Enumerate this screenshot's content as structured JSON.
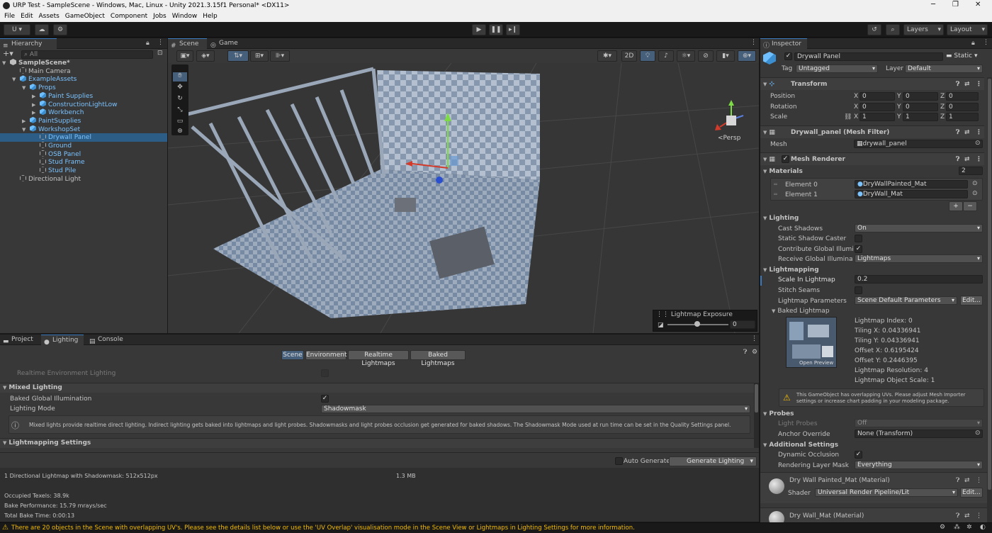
{
  "window": {
    "title": "URP Test - SampleScene - Windows, Mac, Linux - Unity 2021.3.15f1 Personal* <DX11>"
  },
  "menu": [
    "File",
    "Edit",
    "Assets",
    "GameObject",
    "Component",
    "Jobs",
    "Window",
    "Help"
  ],
  "toolbar": {
    "account": "U ▾",
    "layers": "Layers",
    "layout": "Layout"
  },
  "hierarchy": {
    "tab": "Hierarchy",
    "search_placeholder": "All",
    "items": [
      {
        "label": "SampleScene*",
        "depth": 0,
        "icon": "unity-scene-icon",
        "arrow": "▼"
      },
      {
        "label": "Main Camera",
        "depth": 1,
        "icon": "gameobject-icon"
      },
      {
        "label": "ExampleAssets",
        "depth": 1,
        "icon": "prefab-icon",
        "arrow": "▼",
        "blue": true
      },
      {
        "label": "Props",
        "depth": 2,
        "icon": "prefab-icon",
        "arrow": "▼",
        "blue": true
      },
      {
        "label": "Paint Supplies",
        "depth": 3,
        "icon": "prefab-icon",
        "arrow": "▶",
        "blue": true
      },
      {
        "label": "ConstructionLightLow",
        "depth": 3,
        "icon": "prefab-icon",
        "arrow": "▶",
        "blue": true
      },
      {
        "label": "Workbench",
        "depth": 3,
        "icon": "prefab-icon",
        "arrow": "▶",
        "blue": true
      },
      {
        "label": "PaintSupplies",
        "depth": 2,
        "icon": "prefab-icon",
        "arrow": "▶",
        "blue": true
      },
      {
        "label": "WorkshopSet",
        "depth": 2,
        "icon": "prefab-icon",
        "arrow": "▼",
        "blue": true
      },
      {
        "label": "Drywall Panel",
        "depth": 3,
        "icon": "gameobject-icon",
        "blue": true,
        "selected": true
      },
      {
        "label": "Ground",
        "depth": 3,
        "icon": "gameobject-icon",
        "blue": true
      },
      {
        "label": "OSB Panel",
        "depth": 3,
        "icon": "gameobject-icon",
        "blue": true
      },
      {
        "label": "Stud Frame",
        "depth": 3,
        "icon": "gameobject-icon",
        "blue": true
      },
      {
        "label": "Stud Pile",
        "depth": 3,
        "icon": "gameobject-icon",
        "blue": true
      },
      {
        "label": "Directional Light",
        "depth": 1,
        "icon": "gameobject-icon"
      }
    ]
  },
  "scene": {
    "tabs": [
      "Scene",
      "Game"
    ],
    "mode_2d": "2D",
    "gizmo_label": "<Persp",
    "lightmap_exposure": {
      "title": "Lightmap Exposure",
      "value": "0"
    }
  },
  "bottom": {
    "tabs": [
      "Project",
      "Lighting",
      "Console"
    ],
    "subtabs": [
      "Scene",
      "Environment",
      "Realtime Lightmaps",
      "Baked Lightmaps"
    ],
    "realtime_env": "Realtime Environment Lighting",
    "mixed_lighting": "Mixed Lighting",
    "baked_gi": "Baked Global Illumination",
    "lighting_mode_label": "Lighting Mode",
    "lighting_mode_value": "Shadowmask",
    "info_text": "Mixed lights provide realtime direct lighting. Indirect lighting gets baked into lightmaps and light probes. Shadowmasks and light probes occlusion get generated for baked shadows. The Shadowmask Mode used at run time can be set in the Quality Settings panel.",
    "lightmapping_settings": "Lightmapping Settings",
    "auto_generate": "Auto Generate",
    "generate_lighting": "Generate Lighting",
    "stats": {
      "summary": "1 Directional Lightmap with Shadowmask: 512x512px",
      "size": "1.3 MB",
      "occupied": "Occupied Texels: 38.9k",
      "perf": "Bake Performance: 15.79 mrays/sec",
      "time": "Total Bake Time: 0:00:13"
    }
  },
  "inspector": {
    "tab": "Inspector",
    "object_name": "Drywall Panel",
    "static": "Static",
    "tag_label": "Tag",
    "tag_value": "Untagged",
    "layer_label": "Layer",
    "layer_value": "Default",
    "transform": {
      "title": "Transform",
      "position": {
        "label": "Position",
        "x": "0",
        "y": "0",
        "z": "0"
      },
      "rotation": {
        "label": "Rotation",
        "x": "0",
        "y": "0",
        "z": "0"
      },
      "scale": {
        "label": "Scale",
        "x": "1",
        "y": "1",
        "z": "1"
      }
    },
    "mesh_filter": {
      "title": "Drywall_panel (Mesh Filter)",
      "mesh_label": "Mesh",
      "mesh_value": "drywall_panel"
    },
    "mesh_renderer": {
      "title": "Mesh Renderer",
      "materials_label": "Materials",
      "materials_count": "2",
      "elements": [
        {
          "label": "Element 0",
          "value": "DryWallPainted_Mat"
        },
        {
          "label": "Element 1",
          "value": "DryWall_Mat"
        }
      ],
      "plus": "+",
      "minus": "−"
    },
    "lighting": {
      "title": "Lighting",
      "cast_shadows_label": "Cast Shadows",
      "cast_shadows_value": "On",
      "static_shadow": "Static Shadow Caster",
      "contribute_gi": "Contribute Global Illuminat",
      "receive_gi_label": "Receive Global Illuminatio",
      "receive_gi_value": "Lightmaps"
    },
    "lightmapping": {
      "title": "Lightmapping",
      "scale_label": "Scale In Lightmap",
      "scale_value": "0.2",
      "stitch": "Stitch Seams",
      "params_label": "Lightmap Parameters",
      "params_value": "Scene Default Parameters",
      "edit": "Edit...",
      "baked": "Baked Lightmap",
      "open_preview": "Open Preview",
      "info": [
        "Lightmap Index: 0",
        "Tiling X: 0.04336941",
        "Tiling Y: 0.04336941",
        "Offset X: 0.6195424",
        "Offset Y: 0.2446395",
        "Lightmap Resolution: 4",
        "Lightmap Object Scale: 1"
      ]
    },
    "warning": "This GameObject has overlapping UVs. Please adjust Mesh Importer settings or increase chart padding in your modeling package.",
    "probes": {
      "title": "Probes",
      "light_probes_label": "Light Probes",
      "light_probes_value": "Off",
      "anchor_label": "Anchor Override",
      "anchor_value": "None (Transform)"
    },
    "additional": {
      "title": "Additional Settings",
      "dynamic_occlusion": "Dynamic Occlusion",
      "render_layer_label": "Rendering Layer Mask",
      "render_layer_value": "Everything"
    },
    "materials": [
      {
        "name": "Dry Wall Painted_Mat (Material)",
        "shader_label": "Shader",
        "shader_value": "Universal Render Pipeline/Lit",
        "edit": "Edit..."
      },
      {
        "name": "Dry Wall_Mat (Material)"
      }
    ]
  },
  "status": "There are 20 objects in the Scene with overlapping UV's. Please see the details list below or use the 'UV Overlap' visualisation mode in the Scene View or Lightmaps in Lighting Settings for more information.",
  "colors": {
    "accent": "#3a79bb",
    "selection": "#2c5d87",
    "prefab_text": "#7bc3ff",
    "warning": "#f4bc02"
  }
}
